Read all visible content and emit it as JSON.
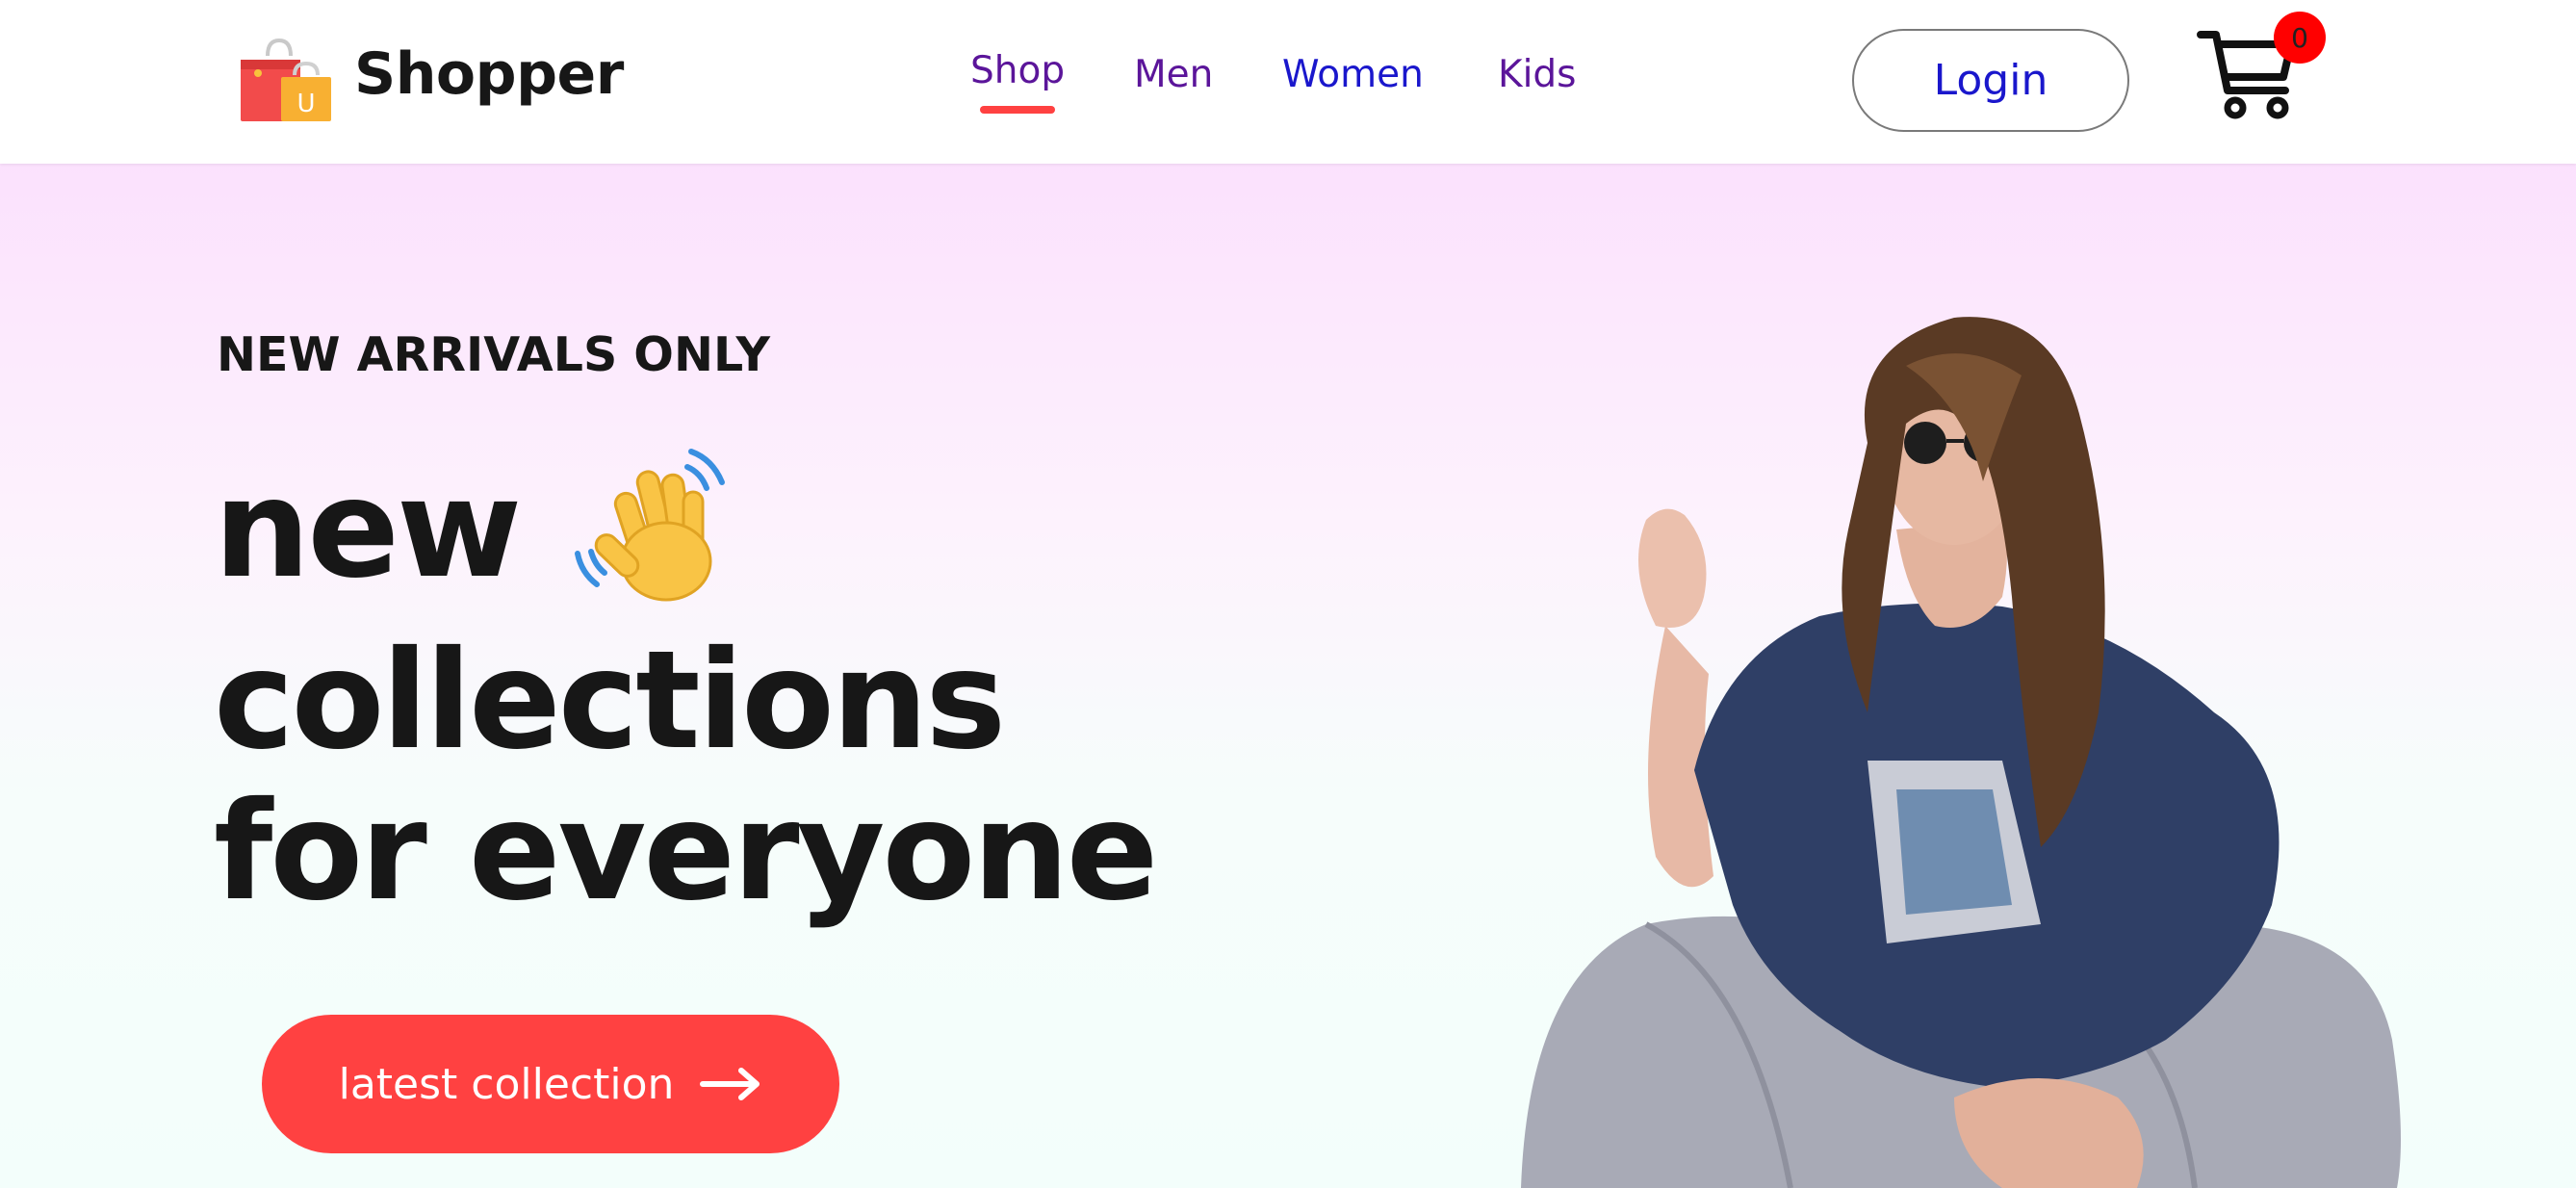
{
  "header": {
    "brand": "Shopper",
    "nav": [
      {
        "label": "Shop",
        "active": true
      },
      {
        "label": "Men"
      },
      {
        "label": "Women"
      },
      {
        "label": "Kids"
      }
    ],
    "login_label": "Login",
    "cart_count": "0"
  },
  "hero": {
    "eyebrow": "NEW ARRIVALS ONLY",
    "headline_line1": "new",
    "headline_line2": "collections",
    "headline_line3": "for everyone",
    "cta_label": "latest collection"
  },
  "icons": {
    "logo": "shopping-bag-icon",
    "cart": "cart-icon",
    "wave": "waving-hand-icon",
    "arrow": "arrow-right-icon"
  },
  "colors": {
    "accent": "#ff4141",
    "nav_visited": "#5b159a",
    "nav_link": "#1a17cc",
    "badge": "#ff0000",
    "hero_top": "#fbe1fd",
    "hero_bottom": "#f3fefb",
    "text": "#171717"
  }
}
